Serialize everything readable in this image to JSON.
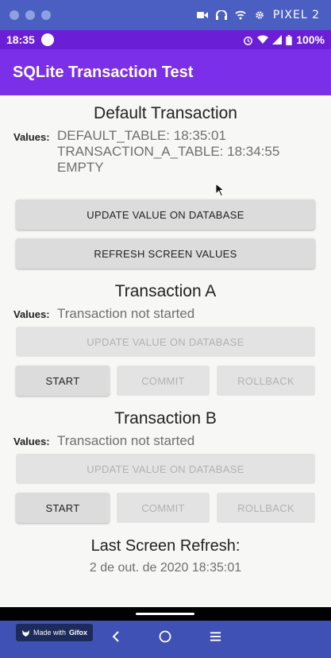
{
  "emulator": {
    "device_name": "PIXEL 2"
  },
  "status_bar": {
    "time": "18:35",
    "battery": "100%"
  },
  "app": {
    "title": "SQLite Transaction Test"
  },
  "default_section": {
    "title": "Default Transaction",
    "values_label": "Values:",
    "values": [
      "DEFAULT_TABLE: 18:35:01",
      "TRANSACTION_A_TABLE: 18:34:55",
      "EMPTY"
    ],
    "update_button": "UPDATE VALUE ON DATABASE",
    "refresh_button": "REFRESH SCREEN VALUES"
  },
  "transaction_a": {
    "title": "Transaction A",
    "values_label": "Values:",
    "value": "Transaction not started",
    "update_button": "UPDATE VALUE ON DATABASE",
    "start_button": "START",
    "commit_button": "COMMIT",
    "rollback_button": "ROLLBACK"
  },
  "transaction_b": {
    "title": "Transaction B",
    "values_label": "Values:",
    "value": "Transaction not started",
    "update_button": "UPDATE VALUE ON DATABASE",
    "start_button": "START",
    "commit_button": "COMMIT",
    "rollback_button": "ROLLBACK"
  },
  "last_refresh": {
    "title": "Last Screen Refresh:",
    "value": "2 de out. de 2020 18:35:01"
  },
  "gifox_badge": {
    "prefix": "Made with",
    "brand": "Gifox"
  },
  "colors": {
    "status_bar": "#6a1fd6",
    "toolbar": "#7b2fe8",
    "background": "#f7f7f5",
    "nav_bar": "#3f51b5"
  }
}
